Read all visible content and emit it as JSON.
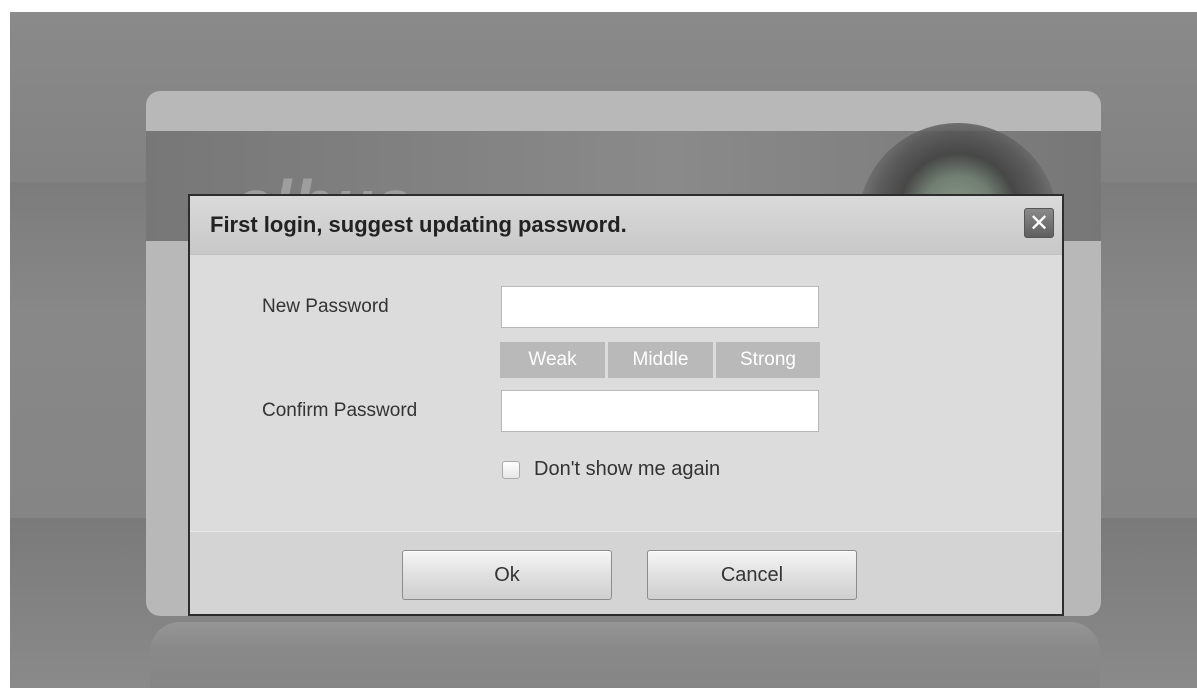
{
  "background": {
    "brand_logo": "alhua"
  },
  "dialog": {
    "title": "First login, suggest updating password.",
    "close_symbol": "✕",
    "new_password_label": "New Password",
    "new_password_value": "",
    "confirm_password_label": "Confirm Password",
    "confirm_password_value": "",
    "strength_levels": [
      "Weak",
      "Middle",
      "Strong"
    ],
    "dont_show_label": "Don't show me again",
    "dont_show_checked": false,
    "ok_label": "Ok",
    "cancel_label": "Cancel"
  },
  "colors": {
    "overlay": "#858585",
    "dialog_bg": "#dcdcdc",
    "strength_inactive": "#b9b9b9",
    "close_button": "#6e6e6e"
  }
}
